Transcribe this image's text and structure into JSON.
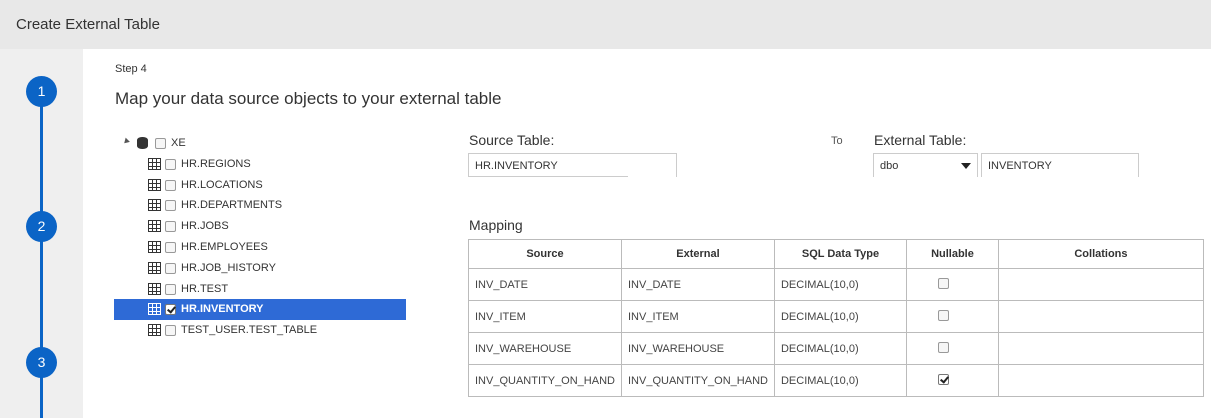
{
  "window": {
    "title": "Create External Table"
  },
  "stepper": {
    "steps": [
      "1",
      "2",
      "3"
    ]
  },
  "step": {
    "label": "Step 4",
    "heading": "Map your data source objects to your external table"
  },
  "tree": {
    "root": {
      "label": "XE",
      "icon": "database-icon",
      "checked": false
    },
    "items": [
      {
        "label": "HR.REGIONS",
        "checked": false,
        "selected": false
      },
      {
        "label": "HR.LOCATIONS",
        "checked": false,
        "selected": false
      },
      {
        "label": "HR.DEPARTMENTS",
        "checked": false,
        "selected": false
      },
      {
        "label": "HR.JOBS",
        "checked": false,
        "selected": false
      },
      {
        "label": "HR.EMPLOYEES",
        "checked": false,
        "selected": false
      },
      {
        "label": "HR.JOB_HISTORY",
        "checked": false,
        "selected": false
      },
      {
        "label": "HR.TEST",
        "checked": false,
        "selected": false
      },
      {
        "label": "HR.INVENTORY",
        "checked": true,
        "selected": true
      },
      {
        "label": "TEST_USER.TEST_TABLE",
        "checked": false,
        "selected": false
      }
    ],
    "selected_color": "#2e6ad6"
  },
  "source": {
    "label": "Source Table:",
    "value": "HR.INVENTORY"
  },
  "to_label": "To",
  "external": {
    "label": "External Table:",
    "schema": "dbo",
    "name": "INVENTORY"
  },
  "mapping": {
    "label": "Mapping",
    "columns": [
      "Source",
      "External",
      "SQL Data Type",
      "Nullable",
      "Collations"
    ],
    "rows": [
      {
        "source": "INV_DATE",
        "external": "INV_DATE",
        "type": "DECIMAL(10,0)",
        "nullable": false,
        "collation": ""
      },
      {
        "source": "INV_ITEM",
        "external": "INV_ITEM",
        "type": "DECIMAL(10,0)",
        "nullable": false,
        "collation": ""
      },
      {
        "source": "INV_WAREHOUSE",
        "external": "INV_WAREHOUSE",
        "type": "DECIMAL(10,0)",
        "nullable": false,
        "collation": ""
      },
      {
        "source": "INV_QUANTITY_ON_HAND",
        "external": "INV_QUANTITY_ON_HAND",
        "type": "DECIMAL(10,0)",
        "nullable": true,
        "collation": ""
      }
    ]
  },
  "colors": {
    "accent": "#0b64c6",
    "titlebar": "#e8e8e8",
    "sidebar": "#efefef"
  }
}
